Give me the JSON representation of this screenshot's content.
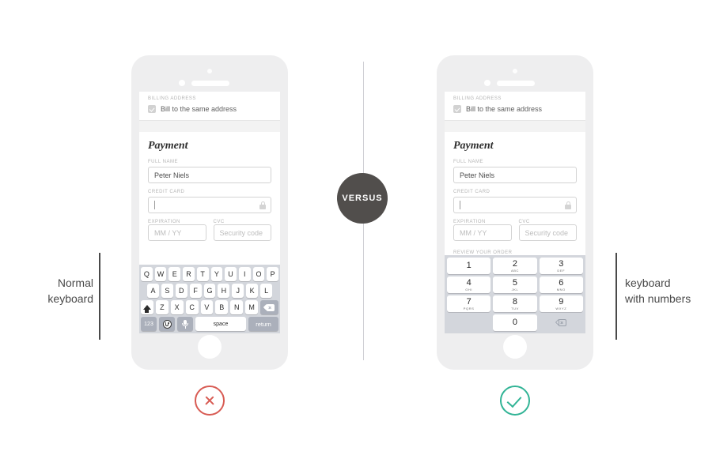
{
  "comparison": {
    "badge_label": "VERSUS",
    "left_caption": "Normal\nkeyboard",
    "left_caption_line1": "Normal",
    "left_caption_line2": "keyboard",
    "right_caption_line1": "keyboard",
    "right_caption_line2": "with numbers",
    "left_verdict": "incorrect",
    "right_verdict": "correct",
    "colors": {
      "badge_bg": "#514e4c",
      "bad": "#d85b53",
      "good": "#32b496",
      "phone_body": "#eeeeef",
      "keyboard_bg": "#d3d6dc",
      "key_bg": "#ffffff",
      "key_dark_bg": "#abb0bb",
      "divider": "#cfcfd4"
    }
  },
  "screen_form": {
    "billing_label": "BILLING ADDRESS",
    "billing_checkbox_label": "Bill to the same address",
    "billing_checkbox_checked": true,
    "payment_title": "Payment",
    "full_name_label": "FULL NAME",
    "full_name_value": "Peter Niels",
    "credit_card_label": "CREDIT CARD",
    "credit_card_value": "",
    "credit_card_icon": "lock-icon",
    "expiration_label": "EXPIRATION",
    "expiration_placeholder": "MM / YY",
    "cvc_label": "CVC",
    "cvc_placeholder": "Security code",
    "review_label": "REVIEW YOUR ORDER"
  },
  "qwerty_keyboard": {
    "row1": [
      "Q",
      "W",
      "E",
      "R",
      "T",
      "Y",
      "U",
      "I",
      "O",
      "P"
    ],
    "row2": [
      "A",
      "S",
      "D",
      "F",
      "G",
      "H",
      "J",
      "K",
      "L"
    ],
    "row3": [
      "Z",
      "X",
      "C",
      "V",
      "B",
      "N",
      "M"
    ],
    "shift_key": "shift-icon",
    "backspace_key": "backspace-icon",
    "numeric_key": "123",
    "emoji_key": "emoji-icon",
    "mic_key": "microphone-icon",
    "space_key": "space",
    "return_key": "return"
  },
  "numeric_keypad": {
    "keys": [
      {
        "digit": "1",
        "letters": ""
      },
      {
        "digit": "2",
        "letters": "ABC"
      },
      {
        "digit": "3",
        "letters": "DEF"
      },
      {
        "digit": "4",
        "letters": "GHI"
      },
      {
        "digit": "5",
        "letters": "JKL"
      },
      {
        "digit": "6",
        "letters": "MNO"
      },
      {
        "digit": "7",
        "letters": "PQRS"
      },
      {
        "digit": "8",
        "letters": "TUV"
      },
      {
        "digit": "9",
        "letters": "WXYZ"
      }
    ],
    "zero": {
      "digit": "0",
      "letters": ""
    },
    "backspace_key": "backspace-icon"
  }
}
